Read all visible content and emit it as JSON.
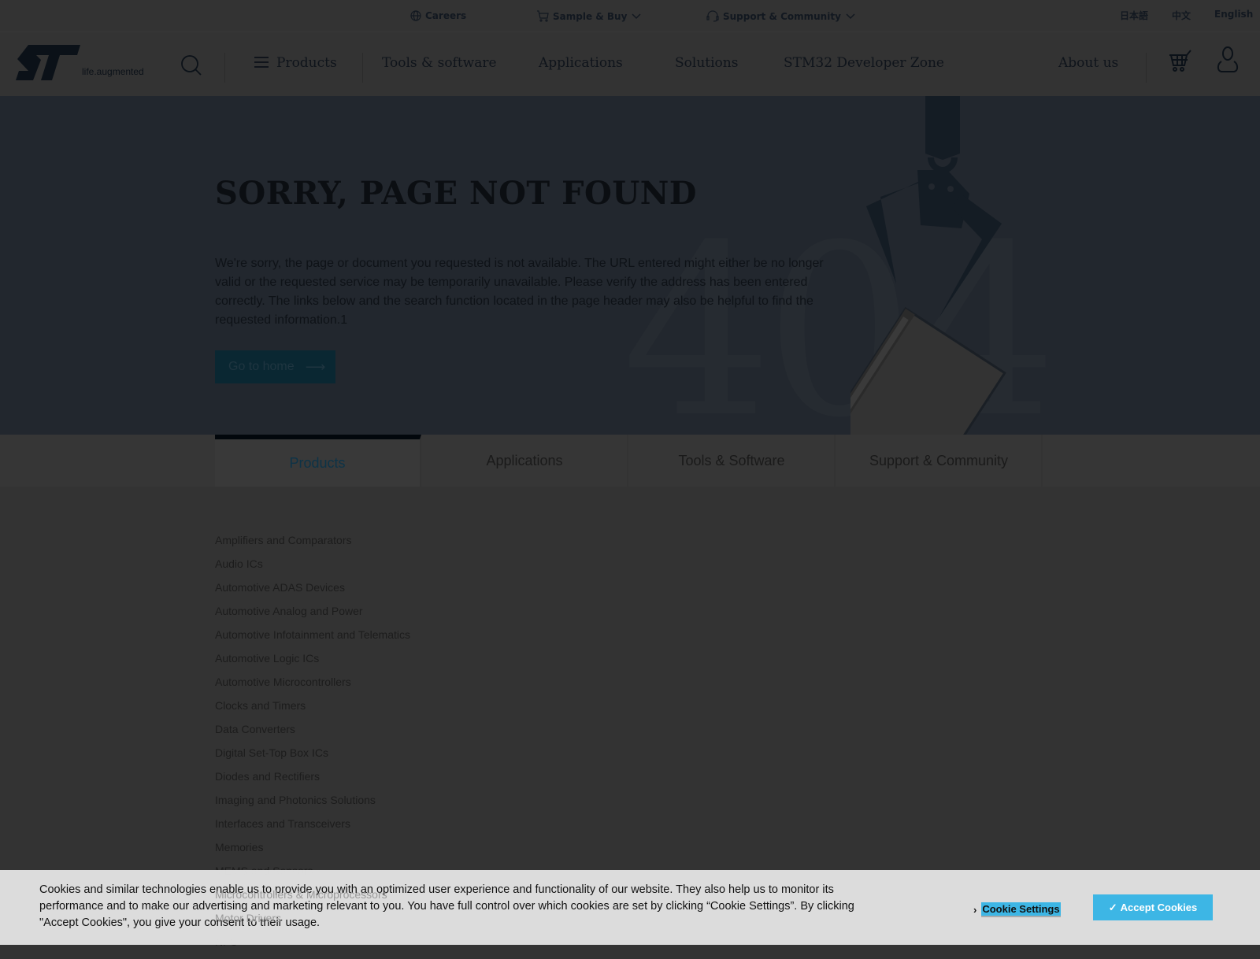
{
  "topbar": {
    "careers": "Careers",
    "sample_buy": "Sample & Buy",
    "support": "Support & Community",
    "languages": [
      "日本語",
      "中文",
      "English"
    ]
  },
  "nav": {
    "logo_tagline": "life.augmented",
    "items": [
      "Products",
      "Tools & software",
      "Applications",
      "Solutions",
      "STM32 Developer Zone",
      "About us"
    ]
  },
  "hero": {
    "title": "SORRY, PAGE NOT FOUND",
    "big_number": "404",
    "description": "We're sorry, the page or document you requested is not available. The URL entered might either be no longer valid or the requested service may be temporarily unavailable. Please verify the address has been entered correctly. The links below and the search function located in the page header may also be helpful to find the requested information.1",
    "button": "Go to home"
  },
  "tabs": [
    {
      "label": "Products",
      "active": true
    },
    {
      "label": "Applications"
    },
    {
      "label": "Tools & Software"
    },
    {
      "label": "Support & Community"
    }
  ],
  "products": [
    "Amplifiers and Comparators",
    "Audio ICs",
    "Automotive ADAS Devices",
    "Automotive Analog and Power",
    "Automotive Infotainment and Telematics",
    "Automotive Logic ICs",
    "Automotive Microcontrollers",
    "Clocks and Timers",
    "Data Converters",
    "Digital Set-Top Box ICs",
    "Diodes and Rectifiers",
    "Imaging and Photonics Solutions",
    "Interfaces and Transceivers",
    "Memories",
    "MEMS and Sensors",
    "Microcontrollers & Microprocessors",
    "Motor Drivers",
    "NFC"
  ],
  "cookie": {
    "text": "Cookies and similar technologies enable us to provide you with an optimized user experience and functionality of our website. They also help us to monitor its performance and to make our advertising and marketing relevant to you. You have full control over which cookies are set by clicking “Cookie Settings”. By clicking \"Accept Cookies\", you give your consent to their usage.",
    "settings": "Cookie Settings",
    "accept": "Accept Cookies"
  },
  "colors": {
    "accent": "#3db6e5",
    "overlay_header": "#333333",
    "hero_bg": "#22272e"
  }
}
